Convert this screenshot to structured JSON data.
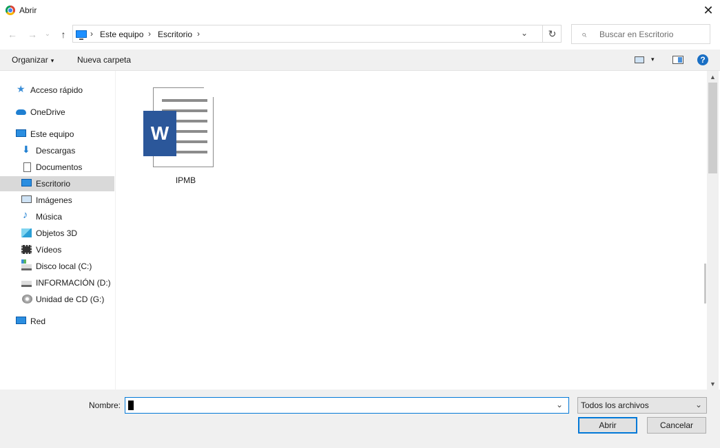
{
  "window": {
    "title": "Abrir",
    "close_glyph": "✕"
  },
  "address": {
    "back_glyph": "←",
    "forward_glyph": "→",
    "recent_glyph": "⌄",
    "up_glyph": "↑",
    "breadcrumbs": [
      "Este equipo",
      "Escritorio"
    ],
    "separator": "›",
    "dropdown_glyph": "⌄",
    "refresh_glyph": "↻"
  },
  "search": {
    "placeholder": "Buscar en Escritorio",
    "icon": "search-icon"
  },
  "toolbar": {
    "organize_label": "Organizar",
    "organize_caret": "▾",
    "new_folder_label": "Nueva carpeta",
    "view_caret": "▾",
    "help_label": "?"
  },
  "sidebar": {
    "items": [
      {
        "label": "Acceso rápido",
        "icon": "quick-access-star-icon"
      },
      {
        "label": "OneDrive",
        "icon": "cloud-icon"
      },
      {
        "label": "Este equipo",
        "icon": "computer-icon"
      },
      {
        "label": "Descargas",
        "icon": "downloads-arrow-icon"
      },
      {
        "label": "Documentos",
        "icon": "documents-icon"
      },
      {
        "label": "Escritorio",
        "icon": "desktop-icon",
        "selected": true
      },
      {
        "label": "Imágenes",
        "icon": "pictures-icon"
      },
      {
        "label": "Música",
        "icon": "music-note-icon"
      },
      {
        "label": "Objetos 3D",
        "icon": "cube-3d-icon"
      },
      {
        "label": "Vídeos",
        "icon": "film-icon"
      },
      {
        "label": "Disco local (C:)",
        "icon": "system-drive-icon"
      },
      {
        "label": "INFORMACIÓN (D:)",
        "icon": "drive-icon"
      },
      {
        "label": "Unidad de CD (G:)",
        "icon": "cd-drive-icon"
      },
      {
        "label": "Red",
        "icon": "network-icon"
      }
    ]
  },
  "content": {
    "files": [
      {
        "name": "IPMB",
        "icon": "word-document-icon",
        "badge": "W"
      }
    ]
  },
  "scrollbar": {
    "up_glyph": "▲",
    "down_glyph": "▼"
  },
  "footer": {
    "name_label": "Nombre:",
    "name_value": "",
    "name_dropdown_glyph": "⌄",
    "filter_value": "Todos los archivos",
    "filter_caret": "⌄",
    "open_label": "Abrir",
    "cancel_label": "Cancelar"
  },
  "colors": {
    "accent": "#0078d7",
    "word_blue": "#2b579a",
    "selection": "#d9d9d9",
    "toolbar_bg": "#f0f0f0"
  }
}
